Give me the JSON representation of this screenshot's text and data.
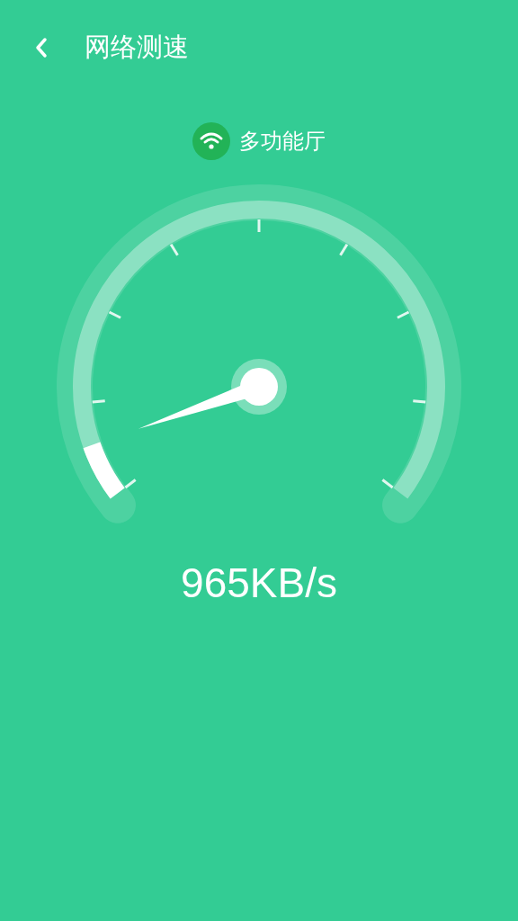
{
  "header": {
    "title": "网络测速"
  },
  "network": {
    "name": "多功能厅"
  },
  "speed": "965KB/s"
}
